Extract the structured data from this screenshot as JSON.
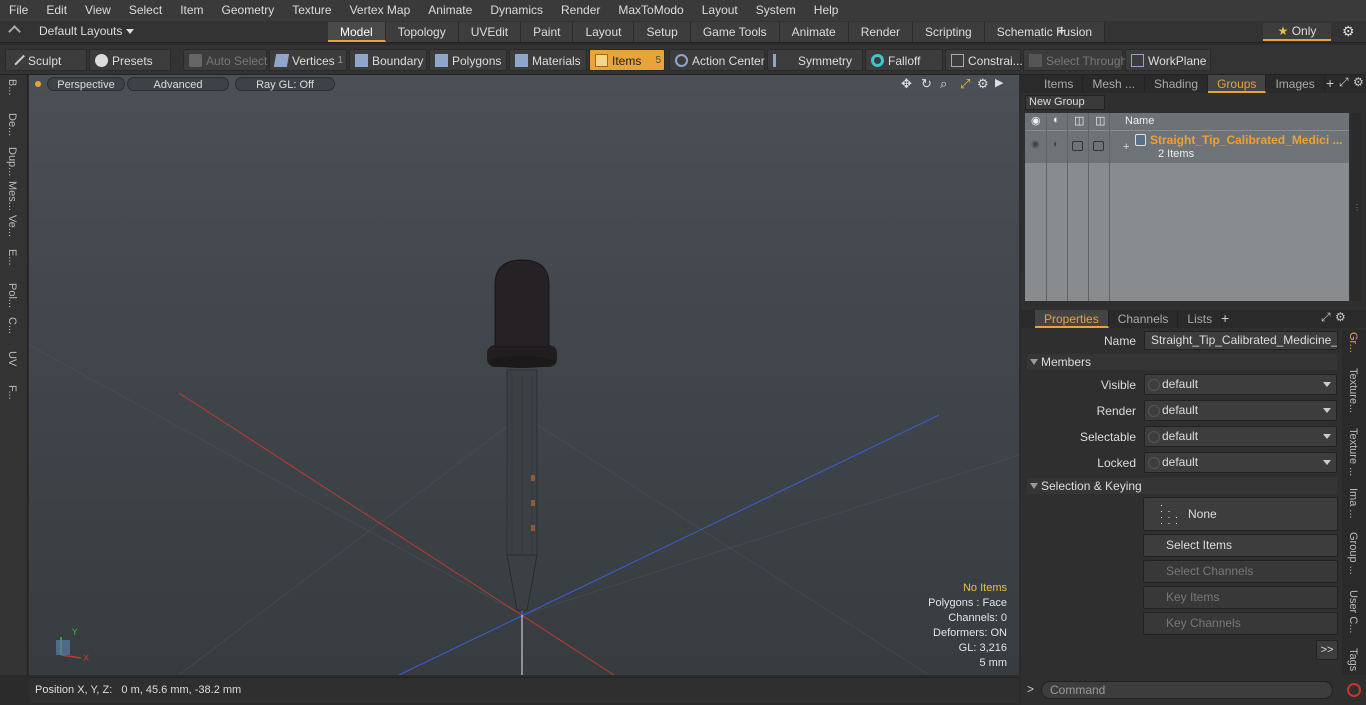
{
  "menu": [
    "File",
    "Edit",
    "View",
    "Select",
    "Item",
    "Geometry",
    "Texture",
    "Vertex Map",
    "Animate",
    "Dynamics",
    "Render",
    "MaxToModo",
    "Layout",
    "System",
    "Help"
  ],
  "layout_selector": "Default Layouts",
  "mode_tabs": [
    "Model",
    "Topology",
    "UVEdit",
    "Paint",
    "Layout",
    "Setup",
    "Game Tools",
    "Animate",
    "Render",
    "Scripting",
    "Schematic Fusion"
  ],
  "active_mode_tab": "Model",
  "only_label": "Only",
  "toolbar": {
    "sculpt": "Sculpt",
    "presets": "Presets",
    "auto_select": "Auto Select",
    "vertices": "Vertices",
    "vertices_count": "1",
    "boundary": "Boundary",
    "polygons": "Polygons",
    "materials": "Materials",
    "items": "Items",
    "items_count": "5",
    "action_center": "Action Center",
    "symmetry": "Symmetry",
    "falloff": "Falloff",
    "constraints": "Constrai...",
    "select_through": "Select Through",
    "workplane": "WorkPlane"
  },
  "left_tabs": [
    "B...",
    "De...",
    "Dup...",
    "Mes...",
    "Ve...",
    "E...",
    "Pol...",
    "C...",
    "UV",
    "F..."
  ],
  "viewport": {
    "perspective": "Perspective",
    "advanced": "Advanced",
    "raygl": "Ray GL: Off",
    "info": {
      "no_items": "No Items",
      "polygons": "Polygons : Face",
      "channels": "Channels: 0",
      "deformers": "Deformers: ON",
      "gl": "GL: 3,216",
      "scale": "5 mm"
    }
  },
  "status": "Position X, Y, Z:   0 m, 45.6 mm, -38.2 mm",
  "top_panel": {
    "tabs": [
      "Items",
      "Mesh ...",
      "Shading",
      "Groups",
      "Images"
    ],
    "active_tab": "Groups",
    "new_group": "New Group",
    "column_name": "Name",
    "group_name": "Straight_Tip_Calibrated_Medici ...",
    "group_count": "2 Items"
  },
  "props_panel": {
    "tabs": [
      "Properties",
      "Channels",
      "Lists"
    ],
    "active_tab": "Properties",
    "name_label": "Name",
    "name_value": "Straight_Tip_Calibrated_Medicine_Drc",
    "members_header": "Members",
    "fields": [
      {
        "label": "Visible",
        "value": "default"
      },
      {
        "label": "Render",
        "value": "default"
      },
      {
        "label": "Selectable",
        "value": "default"
      },
      {
        "label": "Locked",
        "value": "default"
      }
    ],
    "sel_key_header": "Selection & Keying",
    "none_btn": "None",
    "select_items": "Select Items",
    "select_channels": "Select Channels",
    "key_items": "Key Items",
    "key_channels": "Key Channels",
    "more": ">>",
    "side_tabs": [
      "Gr...",
      "Texture...",
      "Texture ...",
      "Ima ...",
      "Group ...",
      "User C...",
      "Tags"
    ]
  },
  "command_placeholder": "Command",
  "accent": "#e8a33a"
}
